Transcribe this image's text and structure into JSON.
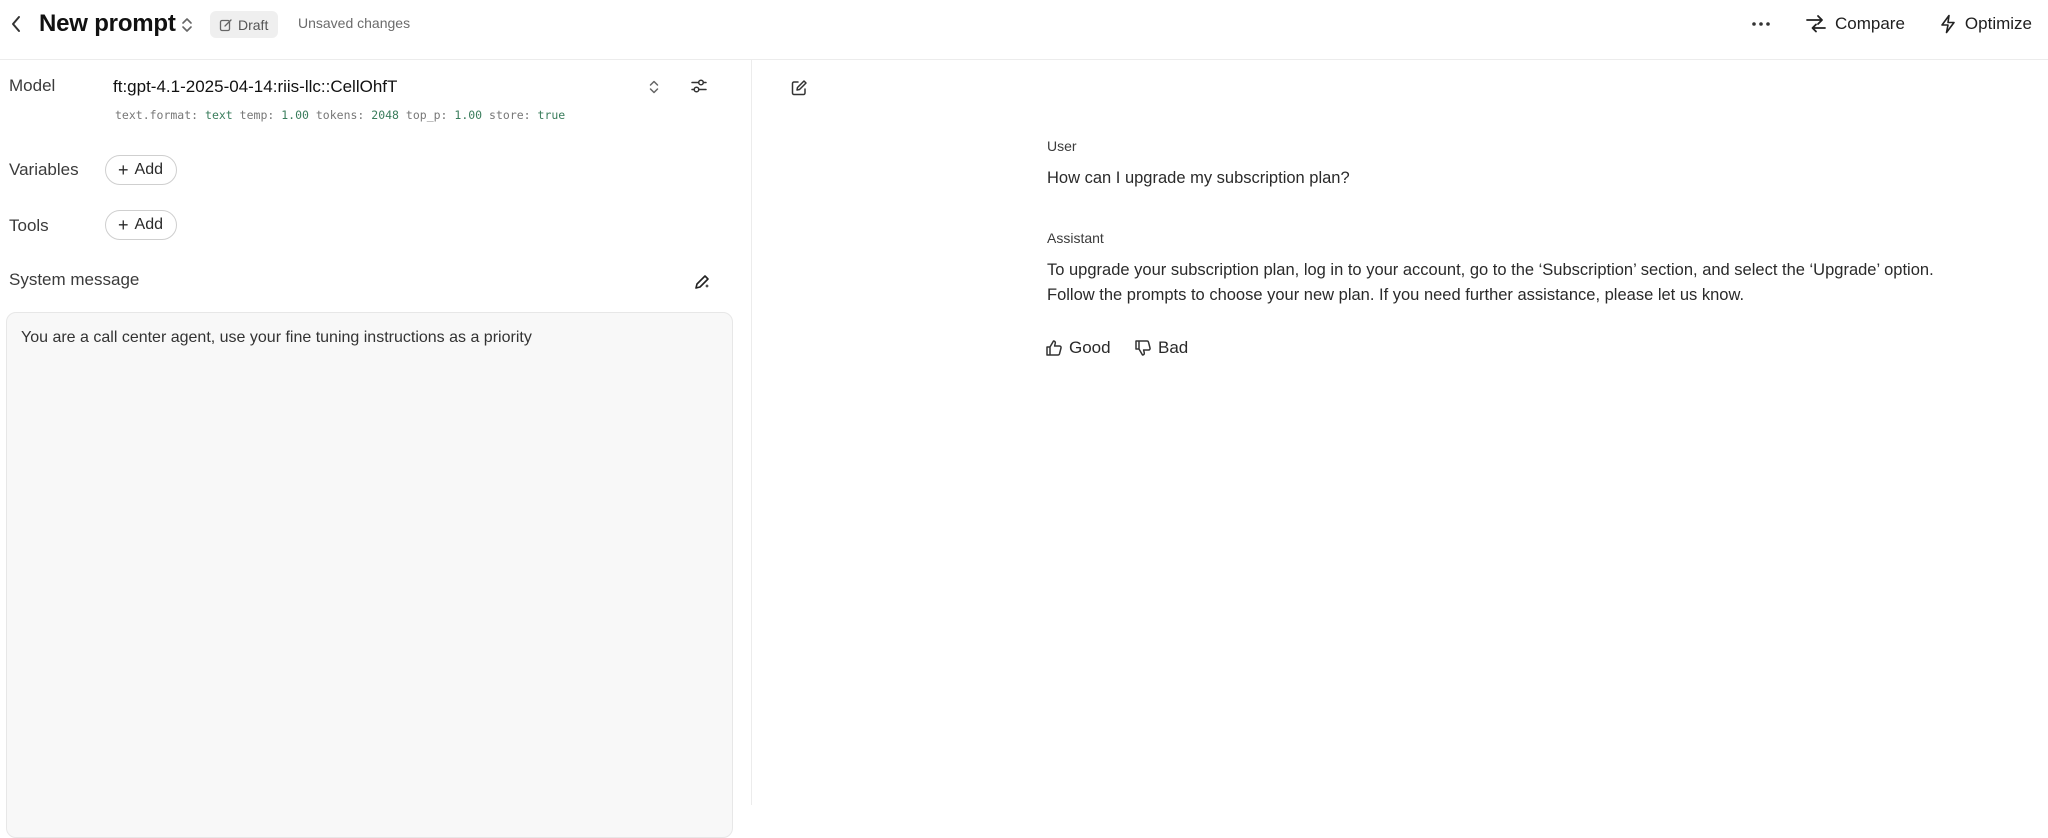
{
  "header": {
    "title": "New prompt",
    "draft_label": "Draft",
    "status": "Unsaved changes",
    "more_label": "···",
    "compare_label": "Compare",
    "optimize_label": "Optimize"
  },
  "config": {
    "model_label": "Model",
    "model_name": "ft:gpt-4.1-2025-04-14:riis-llc::CellOhfT",
    "meta": [
      {
        "key": "text.format:",
        "value": "text"
      },
      {
        "key": "temp:",
        "value": "1.00"
      },
      {
        "key": "tokens:",
        "value": "2048"
      },
      {
        "key": "top_p:",
        "value": "1.00"
      },
      {
        "key": "store:",
        "value": "true"
      }
    ],
    "variables_label": "Variables",
    "tools_label": "Tools",
    "add_label": "Add",
    "system_label": "System message",
    "system_text": "You are a call center agent, use your fine tuning instructions as a priority"
  },
  "conversation": {
    "user_role": "User",
    "user_text": "How can I upgrade my subscription plan?",
    "assistant_role": "Assistant",
    "assistant_line1": "To upgrade your subscription plan, log in to your account, go to the ‘Subscription’ section, and select the ‘Upgrade’ option.",
    "assistant_line2": "Follow the prompts to choose your new plan. If you need further assistance, please let us know.",
    "good_label": "Good",
    "bad_label": "Bad"
  },
  "icons": {
    "back": "chevron-left-icon",
    "title_toggle": "chevron-updown-icon",
    "draft": "edit-icon",
    "more": "ellipsis-icon",
    "compare": "compare-arrows-icon",
    "optimize": "lightning-icon",
    "model_select": "chevron-updown-icon",
    "model_settings": "sliders-icon",
    "system_generate": "pen-sparkle-icon",
    "edit_conversation": "edit-square-icon",
    "good": "thumbs-up-icon",
    "bad": "thumbs-down-icon"
  }
}
